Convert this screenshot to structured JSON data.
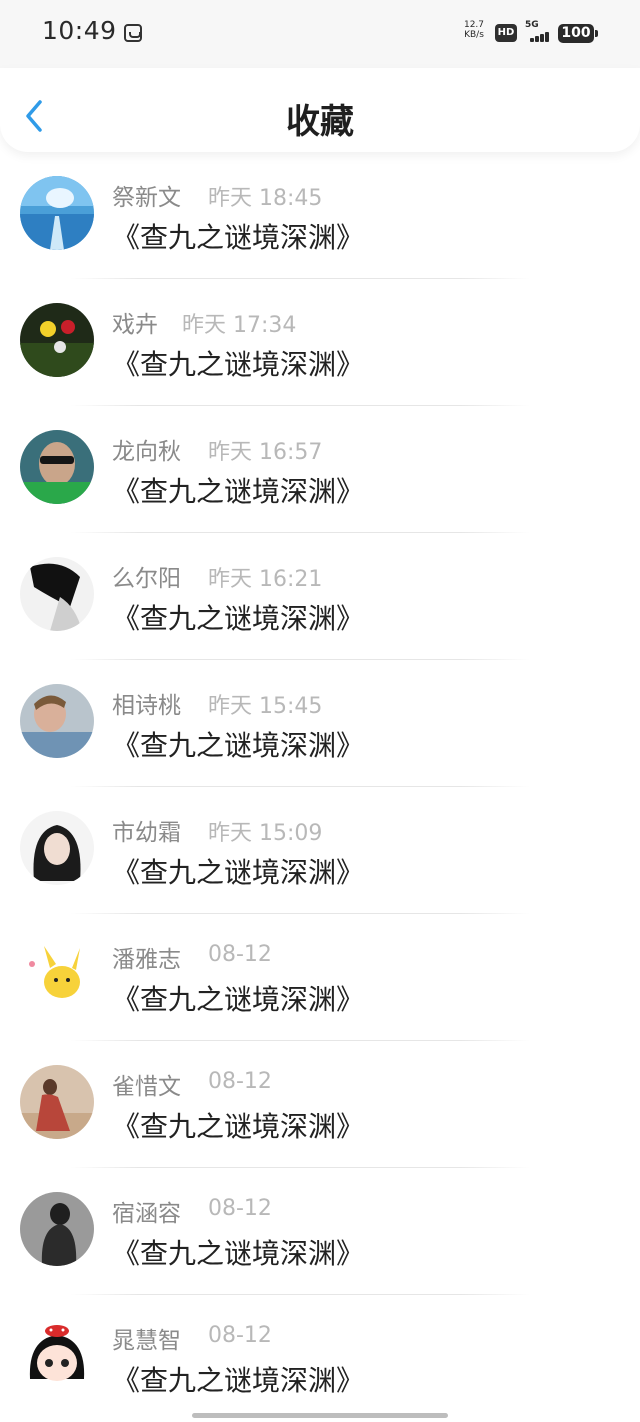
{
  "status_bar": {
    "time": "10:49",
    "net_speed_top": "12.7",
    "net_speed_bottom": "KB/s",
    "hd": "HD",
    "network": "5G",
    "battery": "100"
  },
  "header": {
    "title": "收藏"
  },
  "items": [
    {
      "name": "祭新文",
      "time": "昨天 18:45",
      "title": "《查九之谜境深渊》"
    },
    {
      "name": "戏卉",
      "time": "昨天 17:34",
      "title": "《查九之谜境深渊》"
    },
    {
      "name": "龙向秋",
      "time": "昨天 16:57",
      "title": "《查九之谜境深渊》"
    },
    {
      "name": "么尔阳",
      "time": "昨天 16:21",
      "title": "《查九之谜境深渊》"
    },
    {
      "name": "相诗桃",
      "time": "昨天 15:45",
      "title": "《查九之谜境深渊》"
    },
    {
      "name": "市幼霜",
      "time": "昨天 15:09",
      "title": "《查九之谜境深渊》"
    },
    {
      "name": "潘雅志",
      "time": "08-12",
      "title": "《查九之谜境深渊》"
    },
    {
      "name": "雀惜文",
      "time": "08-12",
      "title": "《查九之谜境深渊》"
    },
    {
      "name": "宿涵容",
      "time": "08-12",
      "title": "《查九之谜境深渊》"
    },
    {
      "name": "晁慧智",
      "time": "08-12",
      "title": "《查九之谜境深渊》"
    }
  ],
  "colors": {
    "accent": "#2f9be8",
    "name": "#8a8a8a",
    "timestamp": "#b8b8b8",
    "title": "#222222"
  }
}
